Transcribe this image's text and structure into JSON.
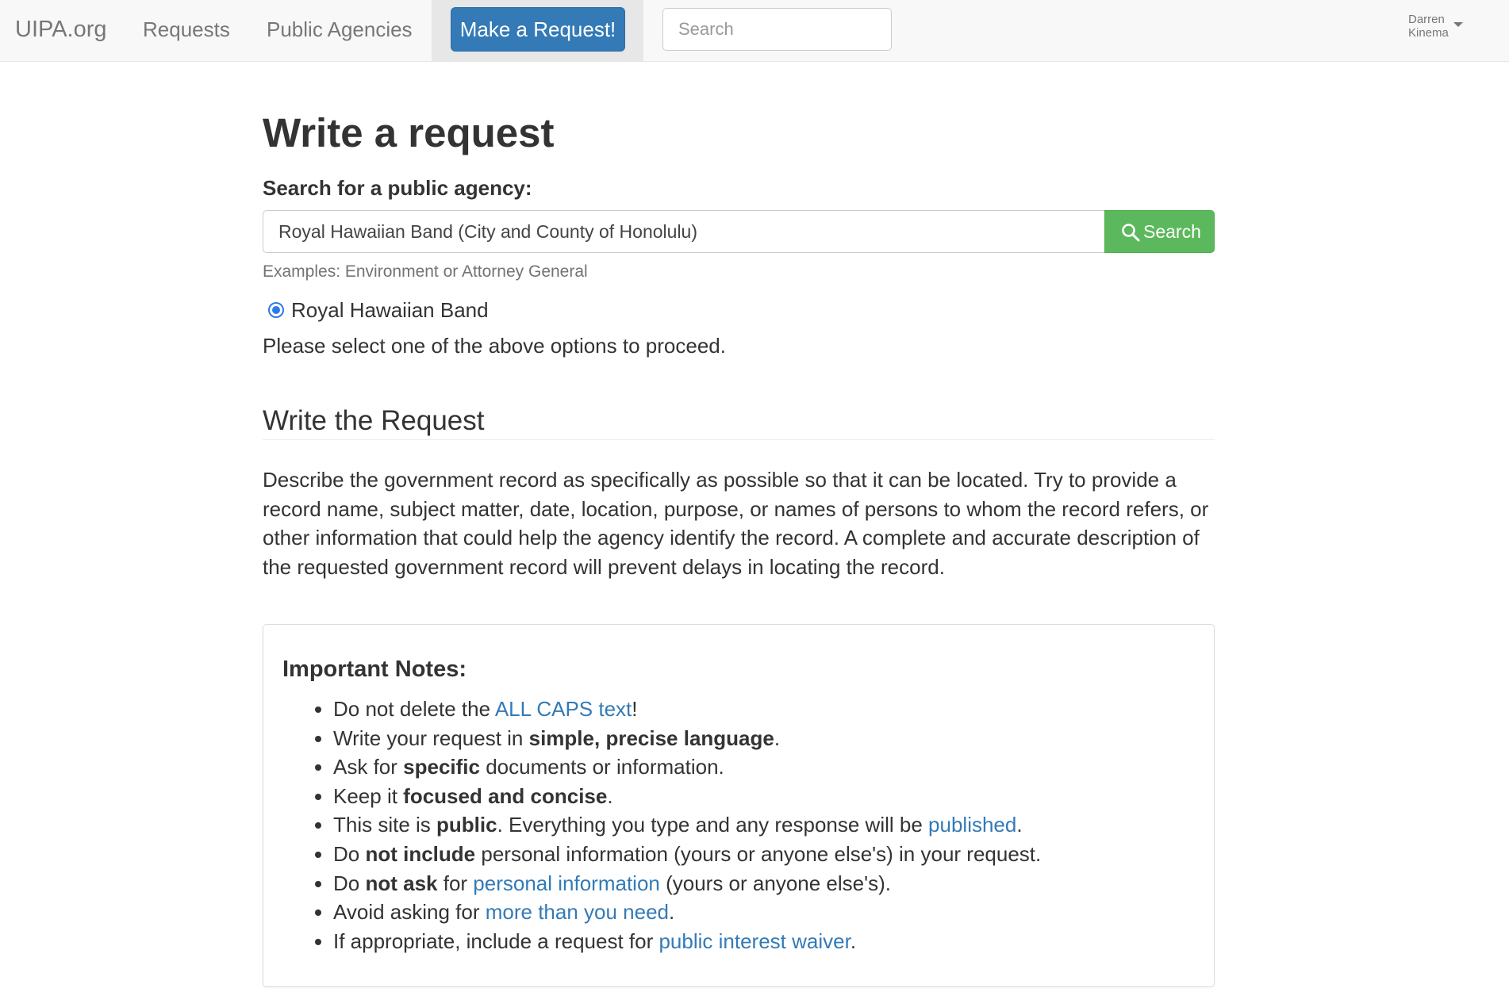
{
  "navbar": {
    "brand": "UIPA.org",
    "links": [
      "Requests",
      "Public Agencies"
    ],
    "cta": "Make a Request!",
    "search_placeholder": "Search",
    "user_first": "Darren",
    "user_last": "Kinema"
  },
  "main": {
    "title": "Write a request",
    "agency_label": "Search for a public agency:",
    "agency_input_value": "Royal Hawaiian Band (City and County of Honolulu)",
    "search_button": "Search",
    "examples": "Examples: Environment or Attorney General",
    "option_label": "Royal Hawaiian Band",
    "option_selected": true,
    "select_note": "Please select one of the above options to proceed.",
    "section_title": "Write the Request",
    "description": "Describe the government record as specifically as possible so that it can be located. Try to provide a record name, subject matter, date, location, purpose, or names of persons to whom the record refers, or other information that could help the agency identify the record. A complete and accurate description of the requested government record will prevent delays in locating the record."
  },
  "notes": {
    "title": "Important Notes:",
    "items": [
      {
        "t1": "Do not delete the ",
        "link": "ALL CAPS text",
        "t2": "!"
      },
      {
        "t1": "Write your request in ",
        "bold": "simple, precise language",
        "t2": "."
      },
      {
        "t1": "Ask for ",
        "bold": "specific",
        "t2": " documents or information."
      },
      {
        "t1": "Keep it ",
        "bold": "focused and concise",
        "t2": "."
      },
      {
        "t1": "This site is ",
        "bold": "public",
        "t2": ". Everything you type and any response will be ",
        "link": "published",
        "t3": "."
      },
      {
        "t1": "Do ",
        "bold": "not include",
        "t2": " personal information (yours or anyone else's) in your request."
      },
      {
        "t1": "Do ",
        "bold": "not ask",
        "t2": " for ",
        "link": "personal information",
        "t3": " (yours or anyone else's)."
      },
      {
        "t1": "Avoid asking for ",
        "link": "more than you need",
        "t2": "."
      },
      {
        "t1": "If appropriate, include a request for ",
        "link": "public interest waiver",
        "t2": "."
      }
    ]
  },
  "colors": {
    "primary": "#337ab7",
    "success": "#5cb85c",
    "navbar_bg": "#f8f8f8",
    "link": "#337ab7"
  }
}
